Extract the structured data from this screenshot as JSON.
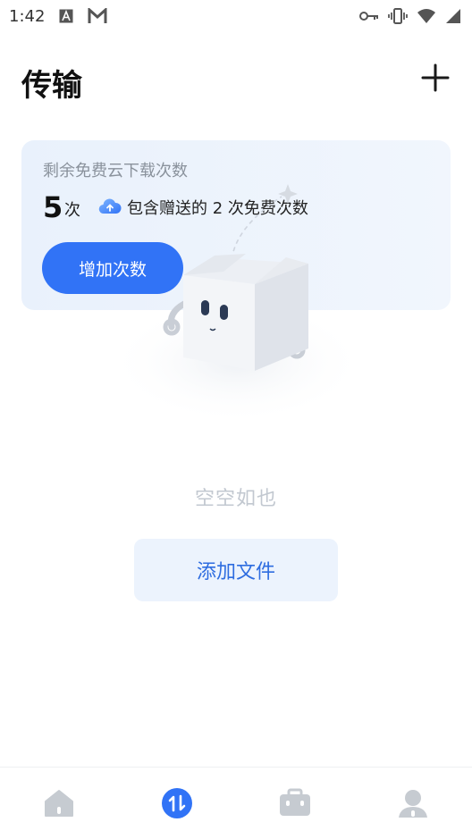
{
  "status_bar": {
    "time": "1:42",
    "icons": [
      "font-icon",
      "gmail-icon",
      "key-icon",
      "vibrate-icon",
      "wifi-icon",
      "signal-icon"
    ]
  },
  "header": {
    "title": "传输",
    "add_icon": "plus-icon"
  },
  "quota": {
    "label": "剩余免费云下载次数",
    "count": "5",
    "unit": "次",
    "note": "包含赠送的 2 次免费次数",
    "button": "增加次数"
  },
  "empty": {
    "message": "空空如也",
    "add_button": "添加文件"
  },
  "bottom_nav": {
    "items": [
      {
        "icon": "home-icon",
        "active": false
      },
      {
        "icon": "transfer-icon",
        "active": true
      },
      {
        "icon": "toolbox-icon",
        "active": false
      },
      {
        "icon": "profile-icon",
        "active": false
      }
    ]
  },
  "colors": {
    "accent": "#3173f6",
    "card_bg": "#e9f1fc",
    "muted_text": "#c2c8d0",
    "nav_inactive": "#c6cbd1"
  }
}
